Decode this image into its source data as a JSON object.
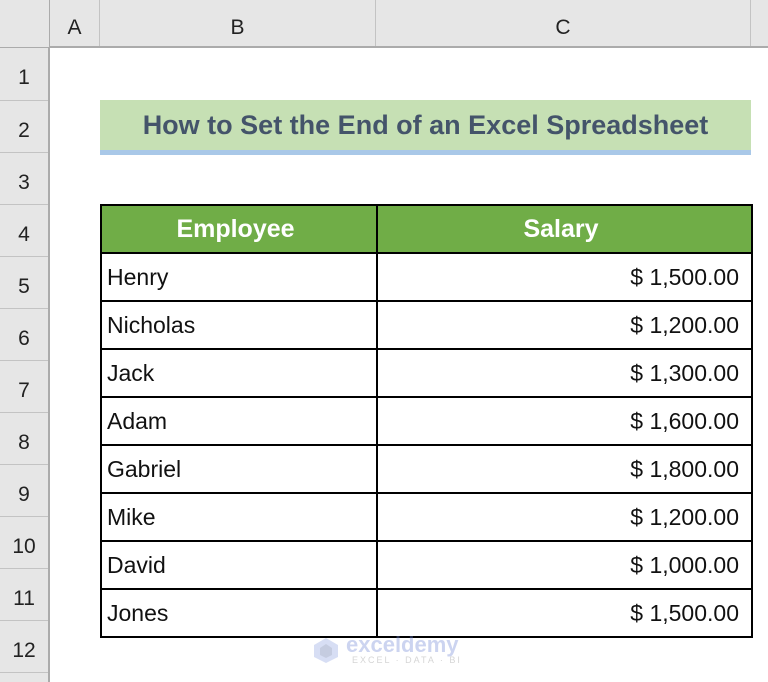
{
  "columns": [
    "A",
    "B",
    "C"
  ],
  "rows": [
    "1",
    "2",
    "3",
    "4",
    "5",
    "6",
    "7",
    "8",
    "9",
    "10",
    "11",
    "12"
  ],
  "title": "How to Set the End of an Excel Spreadsheet",
  "table": {
    "headers": [
      "Employee",
      "Salary"
    ],
    "rows": [
      {
        "employee": "Henry",
        "salary": "$ 1,500.00"
      },
      {
        "employee": "Nicholas",
        "salary": "$ 1,200.00"
      },
      {
        "employee": "Jack",
        "salary": "$ 1,300.00"
      },
      {
        "employee": "Adam",
        "salary": "$ 1,600.00"
      },
      {
        "employee": "Gabriel",
        "salary": "$ 1,800.00"
      },
      {
        "employee": "Mike",
        "salary": "$ 1,200.00"
      },
      {
        "employee": "David",
        "salary": "$ 1,000.00"
      },
      {
        "employee": "Jones",
        "salary": "$ 1,500.00"
      }
    ]
  },
  "colors": {
    "header_fill": "#70ad47",
    "title_fill": "#c6e0b4",
    "title_underline": "#a9c8e8",
    "title_text": "#44546a"
  },
  "watermark": {
    "name": "exceldemy",
    "tagline": "EXCEL · DATA · BI",
    "icon": "exceldemy-logo-icon"
  }
}
